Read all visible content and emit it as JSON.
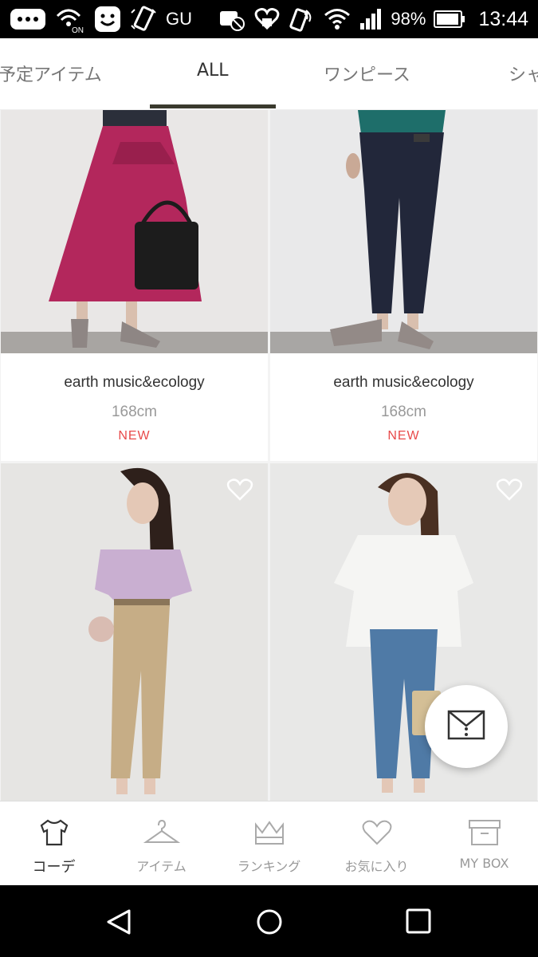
{
  "status_bar": {
    "carrier": "GU",
    "battery_percent": "98%",
    "time": "13:44",
    "icons": [
      "more-icon",
      "wifi-call-icon",
      "smiley-icon",
      "rotate-icon",
      "no-sim-icon",
      "heart-badge-icon",
      "nfc-icon",
      "wifi-icon",
      "signal-icon",
      "battery-icon"
    ]
  },
  "tabs": [
    {
      "label": "予定アイテム",
      "active": false
    },
    {
      "label": "ALL",
      "active": true
    },
    {
      "label": "ワンピース",
      "active": false
    },
    {
      "label": "シャ",
      "active": false
    }
  ],
  "cards": [
    {
      "brand": "earth music&ecology",
      "height": "168cm",
      "badge": "NEW",
      "photo": "model-magenta-skirt-photo"
    },
    {
      "brand": "earth music&ecology",
      "height": "168cm",
      "badge": "NEW",
      "photo": "model-navy-pants-photo"
    },
    {
      "photo": "model-lavender-blouse-photo",
      "favorite_icon": "heart-outline-icon"
    },
    {
      "photo": "model-white-top-jeans-photo",
      "favorite_icon": "heart-outline-icon"
    }
  ],
  "fab": {
    "icon": "envelope-icon"
  },
  "bottom_nav": [
    {
      "label": "コーデ",
      "icon": "tshirt-icon",
      "active": true
    },
    {
      "label": "アイテム",
      "icon": "hanger-icon",
      "active": false
    },
    {
      "label": "ランキング",
      "icon": "crown-icon",
      "active": false
    },
    {
      "label": "お気に入り",
      "icon": "heart-icon",
      "active": false
    },
    {
      "label": "MY BOX",
      "icon": "box-icon",
      "active": false
    }
  ],
  "system_nav": [
    "back-icon",
    "home-icon",
    "recents-icon"
  ],
  "colors": {
    "accent_indicator": "#3a3a2e",
    "new_badge": "#e84a4a"
  }
}
